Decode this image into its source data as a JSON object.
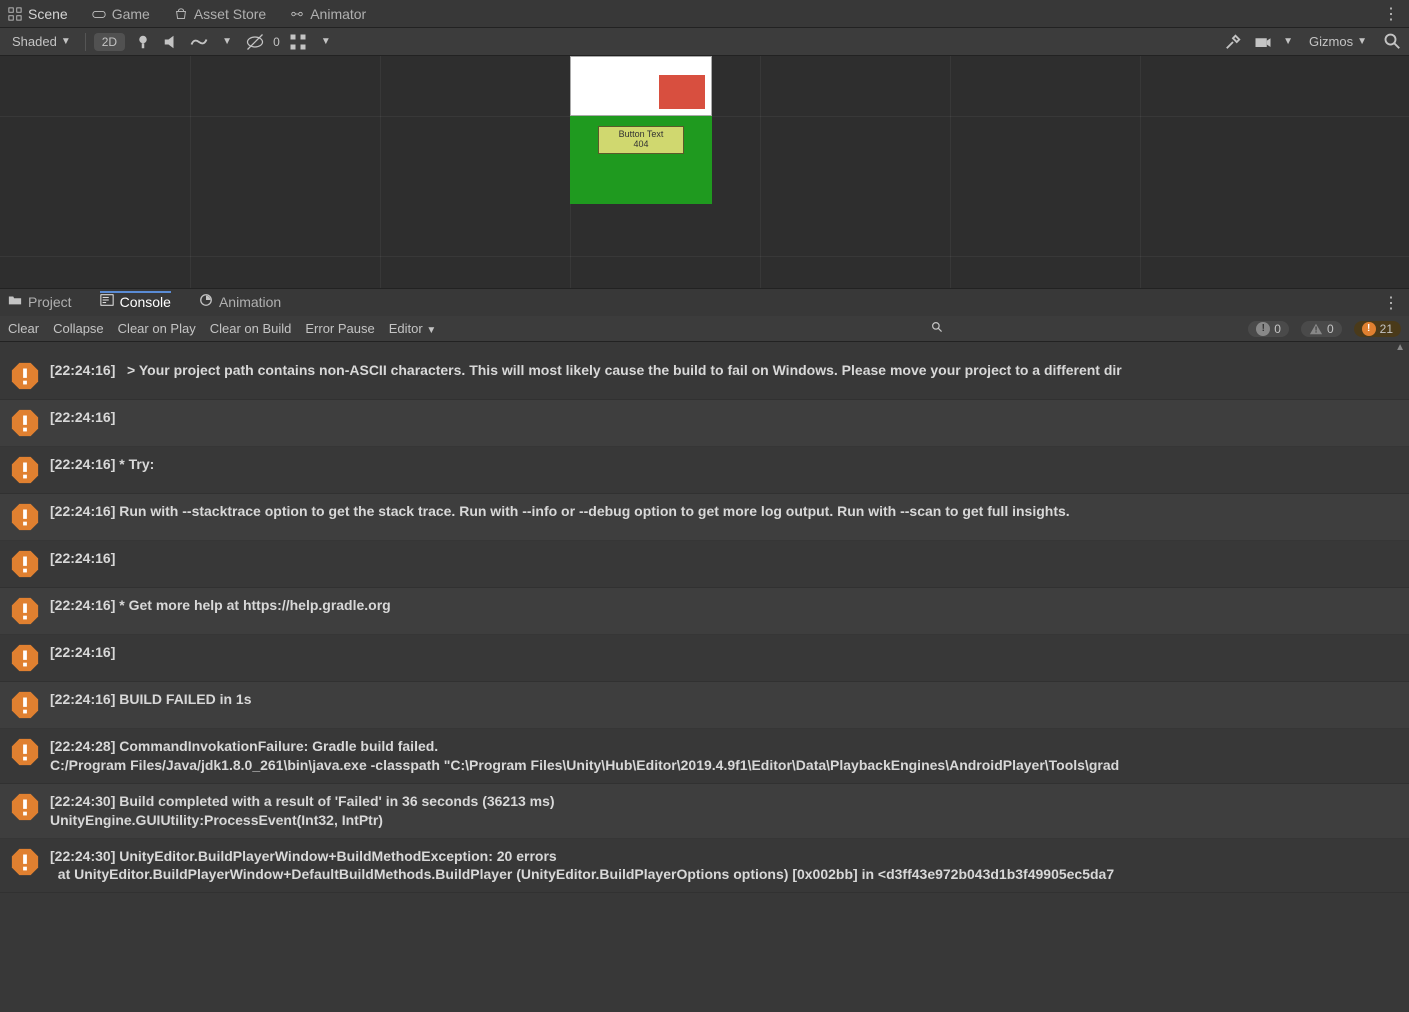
{
  "topTabs": {
    "scene": "Scene",
    "game": "Game",
    "assetStore": "Asset Store",
    "animator": "Animator"
  },
  "sceneToolbar": {
    "shading": "Shaded",
    "mode2d": "2D",
    "layers": "0",
    "gizmos": "Gizmos"
  },
  "sceneLabel": {
    "line1": "Button Text",
    "line2": "404"
  },
  "midTabs": {
    "project": "Project",
    "console": "Console",
    "animation": "Animation"
  },
  "consoleBar": {
    "clear": "Clear",
    "collapse": "Collapse",
    "clearOnPlay": "Clear on Play",
    "clearOnBuild": "Clear on Build",
    "errorPause": "Error Pause",
    "editor": "Editor",
    "counts": {
      "info": "0",
      "warn": "0",
      "error": "21"
    }
  },
  "logs": [
    {
      "type": "error",
      "text": "[22:24:16]   > Your project path contains non-ASCII characters. This will most likely cause the build to fail on Windows. Please move your project to a different dir"
    },
    {
      "type": "error",
      "text": "[22:24:16]"
    },
    {
      "type": "error",
      "text": "[22:24:16] * Try:"
    },
    {
      "type": "error",
      "text": "[22:24:16] Run with --stacktrace option to get the stack trace. Run with --info or --debug option to get more log output. Run with --scan to get full insights."
    },
    {
      "type": "error",
      "text": "[22:24:16]"
    },
    {
      "type": "error",
      "text": "[22:24:16] * Get more help at https://help.gradle.org"
    },
    {
      "type": "error",
      "text": "[22:24:16]"
    },
    {
      "type": "error",
      "text": "[22:24:16] BUILD FAILED in 1s"
    },
    {
      "type": "error",
      "text": "[22:24:28] CommandInvokationFailure: Gradle build failed.\nC:/Program Files/Java/jdk1.8.0_261\\bin\\java.exe -classpath \"C:\\Program Files\\Unity\\Hub\\Editor\\2019.4.9f1\\Editor\\Data\\PlaybackEngines\\AndroidPlayer\\Tools\\grad"
    },
    {
      "type": "error",
      "text": "[22:24:30] Build completed with a result of 'Failed' in 36 seconds (36213 ms)\nUnityEngine.GUIUtility:ProcessEvent(Int32, IntPtr)"
    },
    {
      "type": "error",
      "text": "[22:24:30] UnityEditor.BuildPlayerWindow+BuildMethodException: 20 errors\n  at UnityEditor.BuildPlayerWindow+DefaultBuildMethods.BuildPlayer (UnityEditor.BuildPlayerOptions options) [0x002bb] in <d3ff43e972b043d1b3f49905ec5da7"
    }
  ]
}
